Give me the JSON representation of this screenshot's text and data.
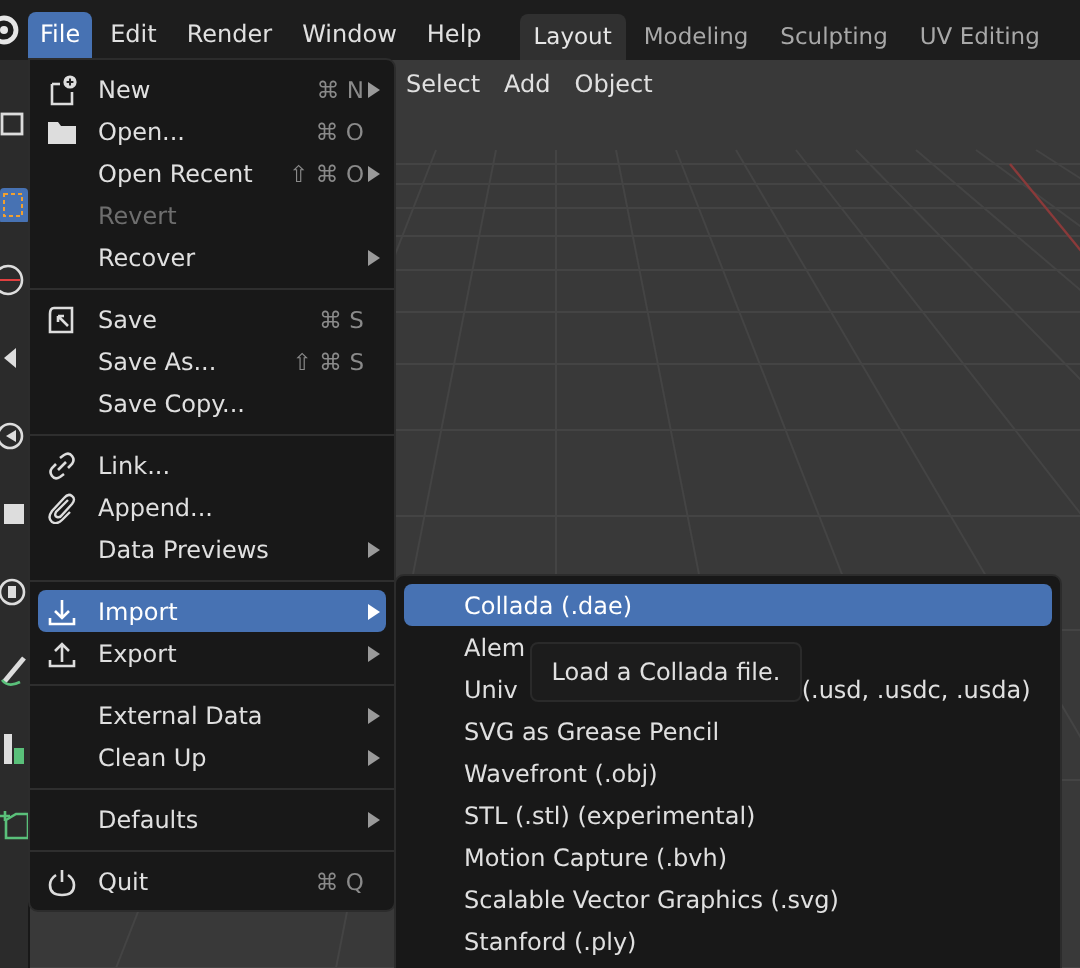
{
  "topbar": {
    "menus": [
      {
        "label": "File",
        "selected": true
      },
      {
        "label": "Edit",
        "selected": false
      },
      {
        "label": "Render",
        "selected": false
      },
      {
        "label": "Window",
        "selected": false
      },
      {
        "label": "Help",
        "selected": false
      }
    ],
    "workspaces": [
      {
        "label": "Layout",
        "selected": true
      },
      {
        "label": "Modeling",
        "selected": false
      },
      {
        "label": "Sculpting",
        "selected": false
      },
      {
        "label": "UV Editing",
        "selected": false
      }
    ]
  },
  "viewport_header": {
    "menus": [
      "Select",
      "Add",
      "Object"
    ]
  },
  "file_menu": [
    {
      "kind": "item",
      "label": "New",
      "shortcut": "⌘ N",
      "submenu": true,
      "disabled": false,
      "selected": false
    },
    {
      "kind": "item",
      "label": "Open...",
      "shortcut": "⌘ O",
      "submenu": false,
      "disabled": false,
      "selected": false
    },
    {
      "kind": "item",
      "label": "Open Recent",
      "shortcut": "⇧ ⌘ O",
      "submenu": true,
      "disabled": false,
      "selected": false
    },
    {
      "kind": "item",
      "label": "Revert",
      "submenu": false,
      "disabled": true,
      "selected": false
    },
    {
      "kind": "item",
      "label": "Recover",
      "submenu": true,
      "disabled": false,
      "selected": false
    },
    {
      "kind": "separator"
    },
    {
      "kind": "item",
      "label": "Save",
      "shortcut": "⌘ S",
      "submenu": false,
      "disabled": false,
      "selected": false
    },
    {
      "kind": "item",
      "label": "Save As...",
      "shortcut": "⇧ ⌘ S",
      "submenu": false,
      "disabled": false,
      "selected": false
    },
    {
      "kind": "item",
      "label": "Save Copy...",
      "submenu": false,
      "disabled": false,
      "selected": false
    },
    {
      "kind": "separator"
    },
    {
      "kind": "item",
      "label": "Link...",
      "submenu": false,
      "disabled": false,
      "selected": false
    },
    {
      "kind": "item",
      "label": "Append...",
      "submenu": false,
      "disabled": false,
      "selected": false
    },
    {
      "kind": "item",
      "label": "Data Previews",
      "submenu": true,
      "disabled": false,
      "selected": false
    },
    {
      "kind": "separator"
    },
    {
      "kind": "item",
      "label": "Import",
      "submenu": true,
      "disabled": false,
      "selected": true
    },
    {
      "kind": "item",
      "label": "Export",
      "submenu": true,
      "disabled": false,
      "selected": false
    },
    {
      "kind": "separator"
    },
    {
      "kind": "item",
      "label": "External Data",
      "submenu": true,
      "disabled": false,
      "selected": false
    },
    {
      "kind": "item",
      "label": "Clean Up",
      "submenu": true,
      "disabled": false,
      "selected": false
    },
    {
      "kind": "separator"
    },
    {
      "kind": "item",
      "label": "Defaults",
      "submenu": true,
      "disabled": false,
      "selected": false
    },
    {
      "kind": "separator"
    },
    {
      "kind": "item",
      "label": "Quit",
      "shortcut": "⌘ Q",
      "submenu": false,
      "disabled": false,
      "selected": false
    }
  ],
  "import_menu": [
    {
      "label": "Collada (.dae)",
      "selected": true
    },
    {
      "label": "Alem",
      "selected": false
    },
    {
      "label": "Univ",
      "label_end": "(.usd, .usdc, .usda)",
      "selected": false
    },
    {
      "label": "SVG as Grease Pencil",
      "selected": false
    },
    {
      "label": "Wavefront (.obj)",
      "selected": false
    },
    {
      "label": "STL (.stl) (experimental)",
      "selected": false
    },
    {
      "label": "Motion Capture (.bvh)",
      "selected": false
    },
    {
      "label": "Scalable Vector Graphics (.svg)",
      "selected": false
    },
    {
      "label": "Stanford (.ply)",
      "selected": false
    }
  ],
  "tooltip": "Load a Collada file."
}
